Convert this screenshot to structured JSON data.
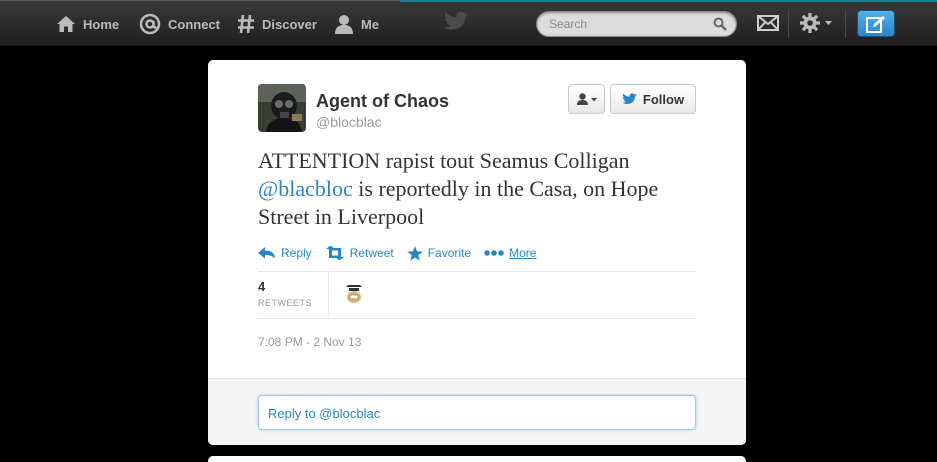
{
  "nav": {
    "home": "Home",
    "connect": "Connect",
    "discover": "Discover",
    "me": "Me"
  },
  "search": {
    "placeholder": "Search"
  },
  "tweet": {
    "author_name": "Agent of Chaos",
    "author_handle": "@blocblac",
    "follow_label": "Follow",
    "text_before": "ATTENTION rapist tout Seamus Colligan ",
    "mention": "@blacbloc",
    "text_after": " is reportedly in the Casa, on Hope Street in Liverpool",
    "actions": {
      "reply": "Reply",
      "retweet": "Retweet",
      "favorite": "Favorite",
      "more": "More"
    },
    "retweet_count": "4",
    "retweet_label": "RETWEETS",
    "timestamp": "7:08 PM - 2 Nov 13"
  },
  "reply": {
    "placeholder": "Reply to @blocblac"
  },
  "colors": {
    "accent": "#2a85c5",
    "compose": "#2a84c6",
    "topbar": "#2b2b2b"
  },
  "icons": [
    "home-icon",
    "connect-icon",
    "discover-icon",
    "me-icon",
    "bird-icon",
    "search-icon",
    "mail-icon",
    "gear-icon",
    "compose-icon",
    "user-dropdown-icon",
    "follow-bird-icon",
    "reply-icon",
    "retweet-icon",
    "favorite-icon",
    "more-icon"
  ]
}
